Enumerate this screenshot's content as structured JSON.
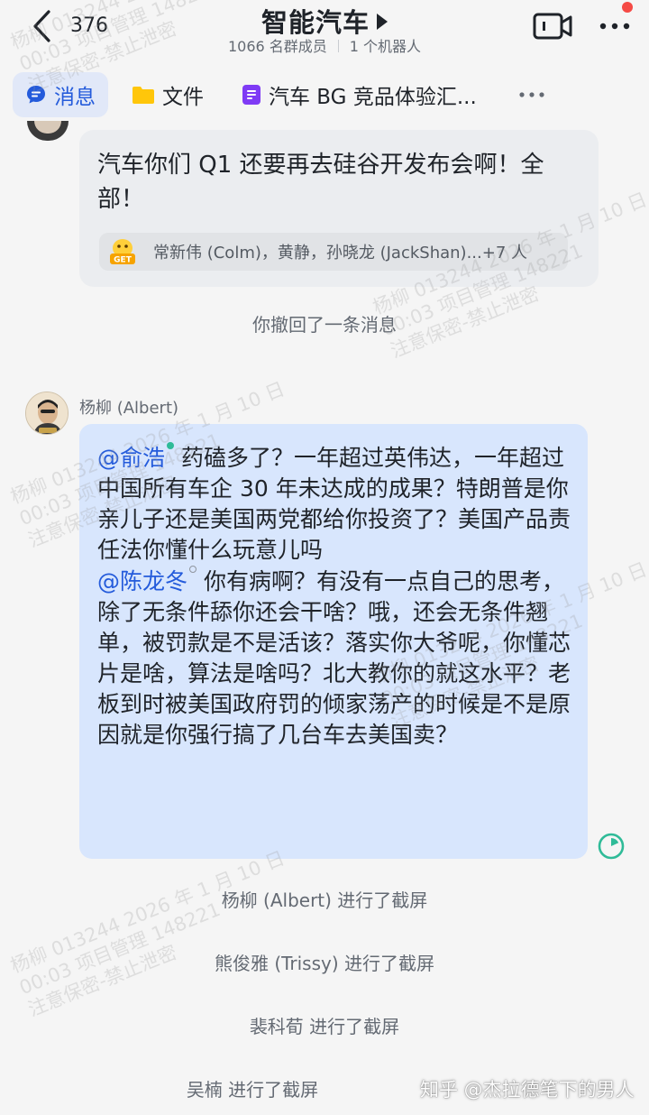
{
  "header": {
    "unread_count": "376",
    "title": "智能汽车",
    "member_count": "1066 名群成员",
    "bot_count": "1 个机器人"
  },
  "tabs": [
    {
      "label": "消息",
      "icon": "chat-bubble-icon",
      "active": true
    },
    {
      "label": "文件",
      "icon": "folder-icon",
      "active": false
    },
    {
      "label": "汽车 BG 竞品体验汇...",
      "icon": "doc-icon",
      "active": false
    }
  ],
  "messages": {
    "first": {
      "text": "汽车你们 Q1 还要再去硅谷开发布会啊！全部！",
      "reaction_names": "常新伟 (Colm)，黄静，孙晓龙 (JackShan)...+7 人",
      "reaction_icon": "GET"
    },
    "recall_notice": "你撤回了一条消息",
    "second": {
      "sender": "杨柳 (Albert)",
      "mention1": "@俞浩",
      "text1": " 药磕多了？一年超过英伟达，一年超过中国所有车企 30 年未达成的成果？特朗普是你亲儿子还是美国两党都给你投资了？美国产品责任法你懂什么玩意儿吗",
      "mention2": "@陈龙冬",
      "text2": " 你有病啊？有没有一点自己的思考，除了无条件舔你还会干啥？哦，还会无条件翘单，被罚款是不是活该？落实你大爷呢，你懂芯片是啥，算法是啥吗？北大教你的就这水平？老板到时被美国政府罚的倾家荡产的时候是不是原因就是你强行搞了几台车去美国卖？"
    },
    "screenshot_notices": [
      "杨柳 (Albert) 进行了截屏",
      "熊俊雅 (Trissy) 进行了截屏",
      "裴科荀 进行了截屏",
      "吴楠 进行了截屏"
    ]
  },
  "watermark": {
    "line1": "杨柳 013244 2026 年 1 月 10 日",
    "line2": "00:03 项目管理 148221",
    "line3": "注意保密-禁止泄密"
  },
  "credit": "知乎 @杰拉德笔下的男人",
  "colors": {
    "accent": "#245bdb",
    "bubble_blue": "#d8e6fd",
    "bubble_grey": "#ebedf0",
    "notify_dot": "#f54a45",
    "read_status": "#2fbb98"
  }
}
